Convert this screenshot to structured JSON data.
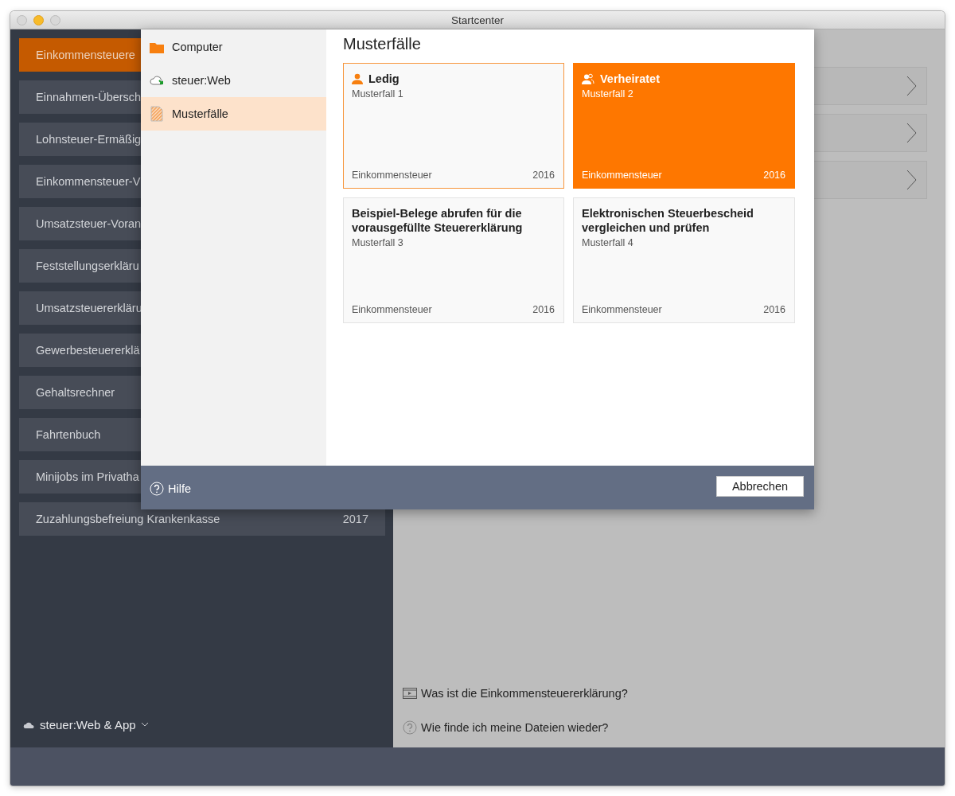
{
  "window": {
    "title": "Startcenter"
  },
  "sidebar": {
    "items": [
      {
        "label": "Einkommensteuere",
        "selected": true
      },
      {
        "label": "Einnahmen-Übersch",
        "selected": false
      },
      {
        "label": "Lohnsteuer-Ermäßig",
        "selected": false
      },
      {
        "label": "Einkommensteuer-V",
        "selected": false
      },
      {
        "label": "Umsatzsteuer-Voran",
        "selected": false
      },
      {
        "label": "Feststellungserkläru",
        "selected": false
      },
      {
        "label": "Umsatzsteuererkläru",
        "selected": false
      },
      {
        "label": "Gewerbesteuererklä",
        "selected": false
      },
      {
        "label": "Gehaltsrechner",
        "selected": false
      },
      {
        "label": "Fahrtenbuch",
        "selected": false
      },
      {
        "label": "Minijobs im Privatha",
        "selected": false
      },
      {
        "label": "Zuzahlungsbefreiung Krankenkasse",
        "year": "2017",
        "selected": false
      }
    ],
    "account": "steuer:Web & App"
  },
  "main": {
    "links": [
      {
        "kind": "video",
        "label": "Was ist die Einkommensteuererklärung?"
      },
      {
        "kind": "help",
        "label": "Wie finde ich meine Dateien wieder?"
      }
    ]
  },
  "dialog": {
    "nav": [
      {
        "kind": "folder",
        "label": "Computer",
        "selected": false
      },
      {
        "kind": "cloud",
        "label": "steuer:Web",
        "selected": false
      },
      {
        "kind": "document",
        "label": "Musterfälle",
        "selected": true
      }
    ],
    "heading": "Musterfälle",
    "cards": [
      {
        "kind": "person",
        "title": "Ledig",
        "subtitle": "Musterfall 1",
        "type": "Einkommensteuer",
        "year": "2016",
        "selected": false,
        "highlighted": true
      },
      {
        "kind": "couple",
        "title": "Verheiratet",
        "subtitle": "Musterfall 2",
        "type": "Einkommensteuer",
        "year": "2016",
        "selected": true,
        "highlighted": false
      },
      {
        "kind": "plain",
        "title": "Beispiel-Belege abrufen für die vorausgefüllte Steuererklärung",
        "subtitle": "Musterfall 3",
        "type": "Einkommensteuer",
        "year": "2016",
        "selected": false,
        "highlighted": false
      },
      {
        "kind": "plain",
        "title": "Elektronischen Steuerbescheid vergleichen und prüfen",
        "subtitle": "Musterfall 4",
        "type": "Einkommensteuer",
        "year": "2016",
        "selected": false,
        "highlighted": false
      }
    ],
    "help": "Hilfe",
    "cancel": "Abbrechen"
  }
}
